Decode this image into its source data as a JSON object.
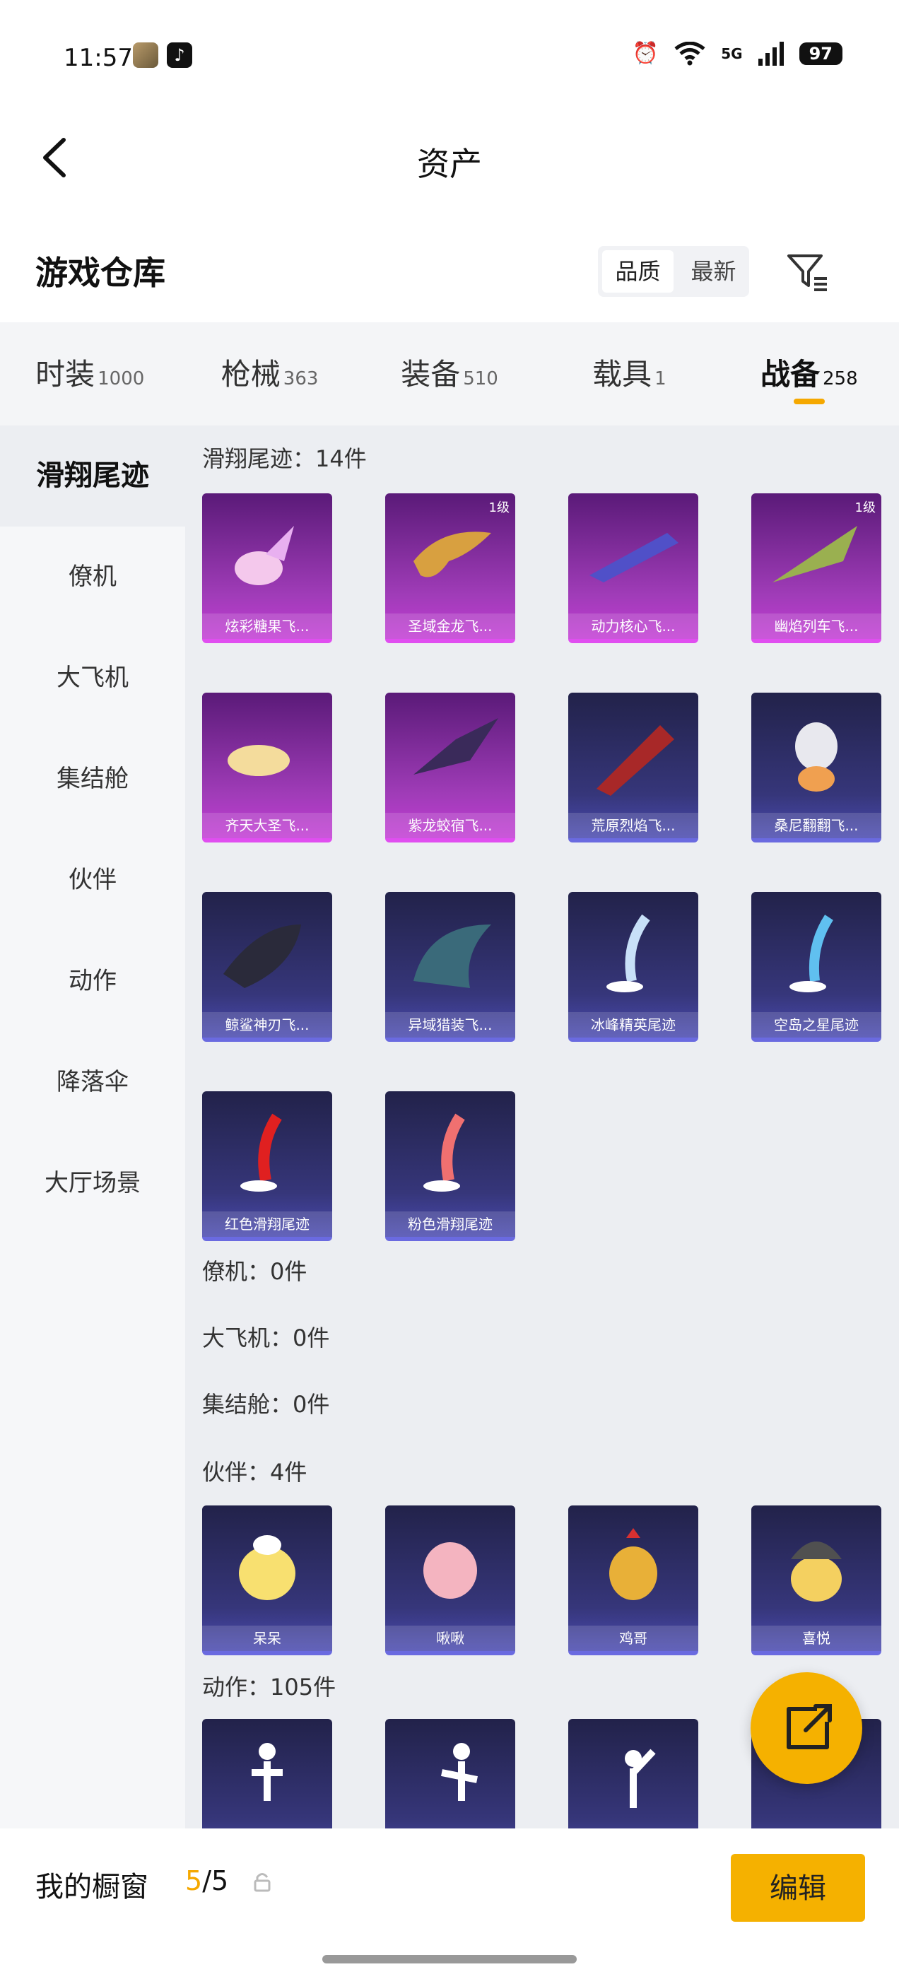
{
  "status": {
    "time": "11:57",
    "network": "5G",
    "battery": "97"
  },
  "header": {
    "title": "资产"
  },
  "subheader": {
    "title": "游戏仓库",
    "sort_options": [
      "品质",
      "最新"
    ]
  },
  "tabs": [
    {
      "label": "时装",
      "count": "1000"
    },
    {
      "label": "枪械",
      "count": "363"
    },
    {
      "label": "装备",
      "count": "510"
    },
    {
      "label": "载具",
      "count": "1"
    },
    {
      "label": "战备",
      "count": "258"
    }
  ],
  "sidebar": [
    "滑翔尾迹",
    "僚机",
    "大飞机",
    "集结舱",
    "伙伴",
    "动作",
    "降落伞",
    "大厅场景"
  ],
  "sections": {
    "trail": {
      "title": "滑翔尾迹：14件"
    },
    "wingman": {
      "title": "僚机：0件"
    },
    "plane": {
      "title": "大飞机：0件"
    },
    "pod": {
      "title": "集结舱：0件"
    },
    "partner": {
      "title": "伙伴：4件"
    },
    "action": {
      "title": "动作：105件"
    }
  },
  "trail_items": [
    {
      "name": "炫彩糖果飞...",
      "level": ""
    },
    {
      "name": "圣域金龙飞...",
      "level": "1级"
    },
    {
      "name": "动力核心飞...",
      "level": ""
    },
    {
      "name": "幽焰列车飞...",
      "level": "1级"
    },
    {
      "name": "齐天大圣飞...",
      "level": ""
    },
    {
      "name": "紫龙蛟宿飞...",
      "level": ""
    },
    {
      "name": "荒原烈焰飞...",
      "level": ""
    },
    {
      "name": "桑尼翻翻飞...",
      "level": ""
    },
    {
      "name": "鲸鲨神刃飞...",
      "level": ""
    },
    {
      "name": "异域猎装飞...",
      "level": ""
    },
    {
      "name": "冰峰精英尾迹",
      "level": ""
    },
    {
      "name": "空岛之星尾迹",
      "level": ""
    },
    {
      "name": "红色滑翔尾迹",
      "level": ""
    },
    {
      "name": "粉色滑翔尾迹",
      "level": ""
    }
  ],
  "partner_items": [
    {
      "name": "呆呆"
    },
    {
      "name": "啾啾"
    },
    {
      "name": "鸡哥"
    },
    {
      "name": "喜悦"
    }
  ],
  "bottom": {
    "label": "我的橱窗",
    "count_current": "5",
    "count_total": "/5",
    "edit": "编辑"
  },
  "colors": {
    "accent": "#f5b100",
    "rare_purple": "#c23cd4",
    "blue_tier": "#4a4ab0"
  }
}
